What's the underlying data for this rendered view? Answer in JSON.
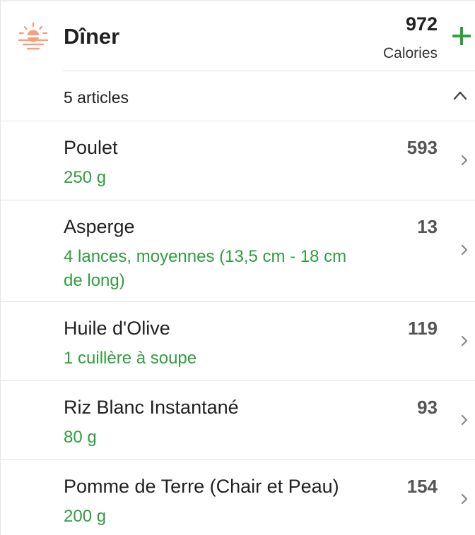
{
  "meal": {
    "title": "Dîner",
    "calories_value": "972",
    "calories_label": "Calories",
    "icon": "sunset-icon",
    "accent_color": "#2e9e3e",
    "icon_color": "#f4a07a"
  },
  "summary": {
    "item_count": "5 articles",
    "expanded": true
  },
  "items": [
    {
      "name": "Poulet",
      "quantity": "250  g",
      "calories": "593"
    },
    {
      "name": "Asperge",
      "quantity": "4  lances, moyennes (13,5 cm - 18 cm de long)",
      "calories": "13"
    },
    {
      "name": "Huile d'Olive",
      "quantity": "1  cuillère à soupe",
      "calories": "119"
    },
    {
      "name": "Riz Blanc Instantané",
      "quantity": "80  g",
      "calories": "93"
    },
    {
      "name": "Pomme de Terre (Chair et Peau)",
      "quantity": "200  g",
      "calories": "154"
    }
  ]
}
